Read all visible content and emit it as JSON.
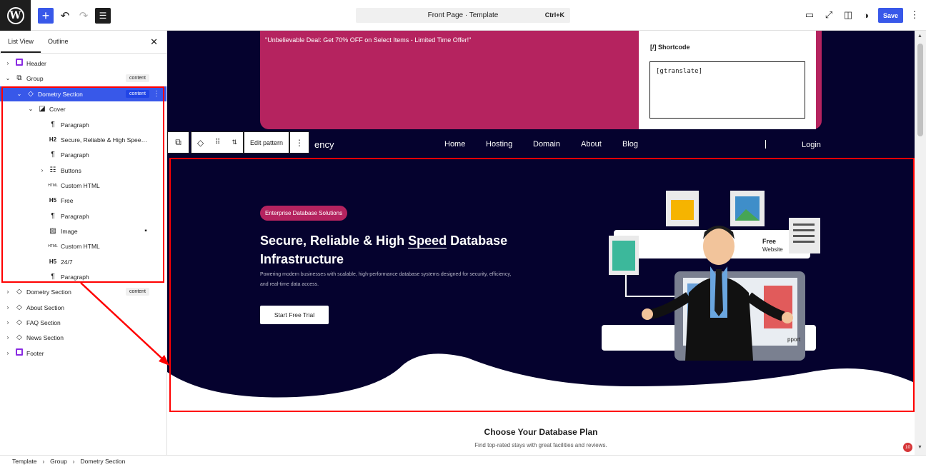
{
  "toolbar": {
    "doc_title": "Front Page · Template",
    "shortcut": "Ctrl+K",
    "save_label": "Save"
  },
  "panel": {
    "tabs": [
      "List View",
      "Outline"
    ],
    "items": [
      {
        "label": "Header",
        "badge": ""
      },
      {
        "label": "Group",
        "badge": "content"
      },
      {
        "label": "Dometry Section",
        "badge": "content"
      },
      {
        "label": "Cover",
        "badge": ""
      },
      {
        "label": "Paragraph",
        "badge": ""
      },
      {
        "label": "Secure, Reliable & High Spee…",
        "badge": ""
      },
      {
        "label": "Paragraph",
        "badge": ""
      },
      {
        "label": "Buttons",
        "badge": ""
      },
      {
        "label": "Custom HTML",
        "badge": ""
      },
      {
        "label": "Free",
        "badge": ""
      },
      {
        "label": "Paragraph",
        "badge": ""
      },
      {
        "label": "Image",
        "badge": ""
      },
      {
        "label": "Custom HTML",
        "badge": ""
      },
      {
        "label": "24/7",
        "badge": ""
      },
      {
        "label": "Paragraph",
        "badge": ""
      },
      {
        "label": "Dometry Section",
        "badge": "content"
      },
      {
        "label": "About Section",
        "badge": ""
      },
      {
        "label": "FAQ Section",
        "badge": ""
      },
      {
        "label": "News Section",
        "badge": ""
      },
      {
        "label": "Footer",
        "badge": ""
      }
    ],
    "heading_tags": {
      "h2": "H2",
      "h5": "H5",
      "html": "HTML"
    }
  },
  "canvas": {
    "promo_text": "\"Unbelievable Deal: Get 70% OFF on Select Items - Limited Time Offer!\"",
    "shortcode_title": "Shortcode",
    "shortcode_icon": "[/]",
    "shortcode_value": "[gtranslate]",
    "brand_fragment": "ency",
    "nav": [
      "Home",
      "Hosting",
      "Domain",
      "About",
      "Blog"
    ],
    "login": "Login",
    "edit_pattern": "Edit pattern",
    "hero": {
      "pill": "Enterprise Database Solutions",
      "headline_pre": "Secure, Reliable & High ",
      "headline_underline": "Speed",
      "headline_post": " Database",
      "headline_line2": " Infrastructure",
      "subtext": "Powering modern businesses with scalable, high-performance database systems designed for security, efficiency, and real-time data access.",
      "cta": "Start Free Trial",
      "illus_free": "Free",
      "illus_website": "Website",
      "illus_support": "pport"
    },
    "plan_title": "Choose Your Database Plan",
    "plan_sub": "Find top-rated stays with great facilities and reviews.",
    "notif_count": "10"
  },
  "breadcrumbs": [
    "Template",
    "Group",
    "Dometry Section"
  ],
  "colors": {
    "accent": "#3858e9",
    "navy": "#05022e",
    "magenta": "#b5235f",
    "highlight": "#ff0000"
  }
}
